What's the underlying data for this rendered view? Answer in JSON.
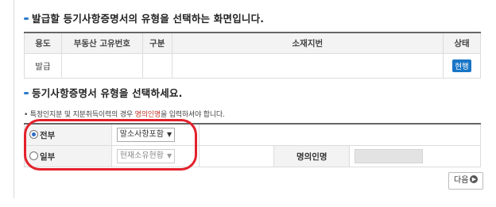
{
  "section1": {
    "title": "발급할 등기사항증명서의 유형을 선택하는 화면입니다.",
    "table": {
      "headers": [
        "용도",
        "부동산 고유번호",
        "구분",
        "소재지번",
        "상태"
      ],
      "row": {
        "purpose": "발급",
        "unique_no": "",
        "type": "",
        "address": "",
        "status": "현행"
      }
    }
  },
  "section2": {
    "title": "등기사항증명서 유형을 선택하세요.",
    "note_pre": "• 특정인지분 및 지분취득이력의 경우 ",
    "note_red": "명의인명",
    "note_post": "을 입력하셔야 합니다.",
    "options": [
      {
        "label": "전부",
        "selected": true,
        "select_value": "말소사항포함",
        "disabled": false
      },
      {
        "label": "일부",
        "selected": false,
        "select_value": "현재소유현황",
        "disabled": true
      }
    ],
    "owner_label": "명의인명",
    "owner_value": ""
  },
  "next_button": "다음",
  "colors": {
    "accent": "#1976c6",
    "highlight": "#e3212b"
  }
}
